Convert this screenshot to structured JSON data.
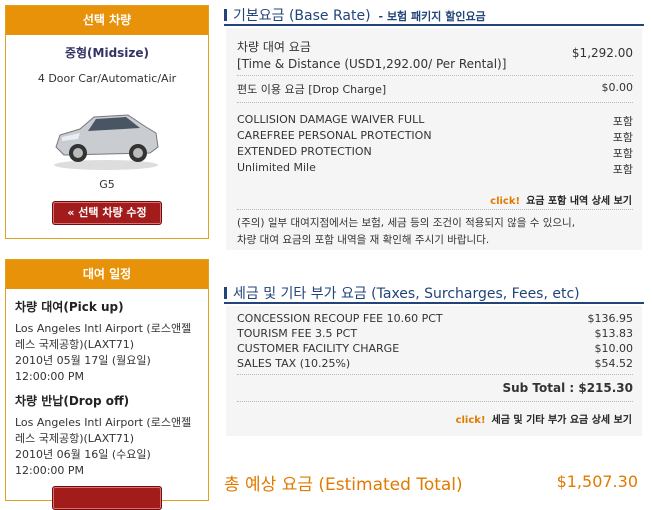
{
  "left": {
    "vehicle": {
      "header": "선택 차량",
      "class": "중형(Midsize)",
      "desc": "4 Door Car/Automatic/Air",
      "model": "G5",
      "modify_button": "« 선택 차량 수정"
    },
    "schedule": {
      "header": "대여 일정",
      "pickup_title": "차량 대여(Pick up)",
      "pickup_loc1": "Los Angeles Intl Airport (로스앤젤",
      "pickup_loc2": "레스 국제공항)(LAXT71)",
      "pickup_date": "2010년 05월 17일 (월요일)",
      "pickup_time": "12:00:00 PM",
      "dropoff_title": "차량 반납(Drop off)",
      "dropoff_loc1": "Los Angeles Intl Airport (로스앤젤",
      "dropoff_loc2": "레스 국제공항)(LAXT71)",
      "dropoff_date": "2010년 06월 16일 (수요일)",
      "dropoff_time": "12:00:00 PM"
    }
  },
  "base": {
    "title": "기본요금 (Base Rate)",
    "subtitle": "- 보험 패키지 할인요금",
    "rental_label1": "차량 대여 요금",
    "rental_label2": "[Time & Distance (USD1,292.00/ Per Rental)]",
    "rental_value": "$1,292.00",
    "drop_label": "편도 이용 요금 [Drop Charge]",
    "drop_value": "$0.00",
    "items": [
      {
        "label": "COLLISION DAMAGE WAIVER FULL",
        "value": "포함"
      },
      {
        "label": "CAREFREE PERSONAL PROTECTION",
        "value": "포함"
      },
      {
        "label": "EXTENDED PROTECTION",
        "value": "포함"
      },
      {
        "label": "Unlimited Mile",
        "value": "포함"
      }
    ],
    "click": "click!",
    "detail": "요금 포함 내역 상세 보기",
    "note1": "(주의) 일부 대여지점에서는 보험, 세금 등의 조건이 적용되지 않을 수 있으니,",
    "note2": "차량 대여 요금의 포함 내역을 재 확인해 주시기 바랍니다."
  },
  "tax": {
    "title": "세금 및 기타 부가 요금 (Taxes, Surcharges, Fees, etc)",
    "items": [
      {
        "label": "CONCESSION RECOUP FEE 10.60 PCT",
        "value": "$136.95"
      },
      {
        "label": "TOURISM FEE 3.5 PCT",
        "value": "$13.83"
      },
      {
        "label": "CUSTOMER FACILITY CHARGE",
        "value": "$10.00"
      },
      {
        "label": "SALES TAX (10.25%)",
        "value": "$54.52"
      }
    ],
    "subtotal": "Sub Total : $215.30",
    "click": "click!",
    "detail": "세금 및 기타 부가 요금 상세 보기"
  },
  "total": {
    "label": "총 예상 요금 (Estimated Total)",
    "value": "$1,507.30"
  }
}
